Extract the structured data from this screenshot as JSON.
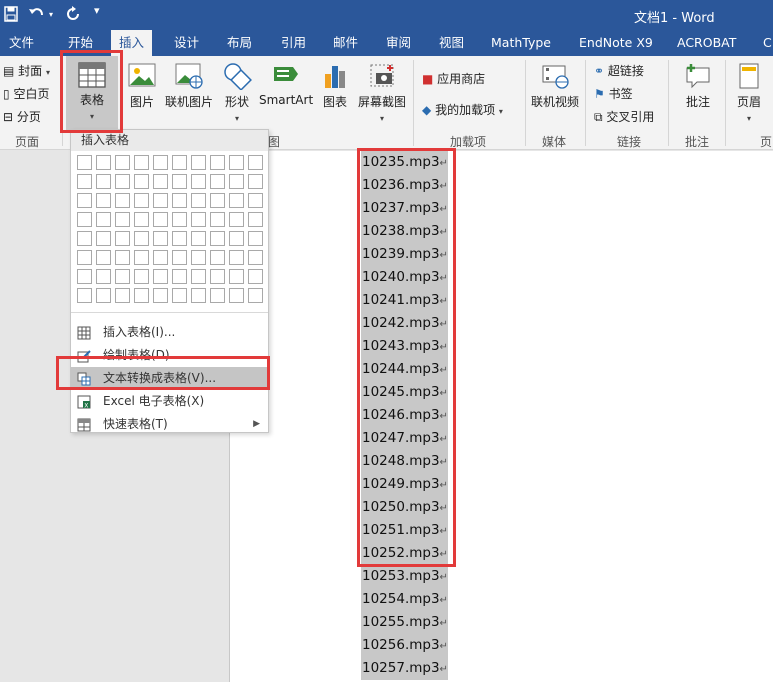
{
  "window": {
    "title": "文档1 - Word"
  },
  "tabs": [
    {
      "label": "文件"
    },
    {
      "label": "开始"
    },
    {
      "label": "插入"
    },
    {
      "label": "设计"
    },
    {
      "label": "布局"
    },
    {
      "label": "引用"
    },
    {
      "label": "邮件"
    },
    {
      "label": "审阅"
    },
    {
      "label": "视图"
    },
    {
      "label": "MathType"
    },
    {
      "label": "EndNote X9"
    },
    {
      "label": "ACROBAT"
    },
    {
      "label": "C"
    }
  ],
  "ribbon": {
    "pages": {
      "cover": "封面",
      "blank": "空白页",
      "break": "分页",
      "group": "页面"
    },
    "table": {
      "label": "表格"
    },
    "picture": "图片",
    "online_picture": "联机图片",
    "shapes": "形状",
    "smartart": "SmartArt",
    "chart": "图表",
    "screenshot": "屏幕截图",
    "illustrations_group_partial": "图",
    "store": "应用商店",
    "my_addins": "我的加载项",
    "addins_group": "加载项",
    "online_video": "联机视频",
    "media_group": "媒体",
    "hyperlink": "超链接",
    "bookmark": "书签",
    "cross_ref": "交叉引用",
    "links_group": "链接",
    "comment": "批注",
    "comments_group": "批注",
    "header": "页眉",
    "header_group_partial": "页"
  },
  "menu": {
    "header": "插入表格",
    "items": [
      {
        "label": "插入表格(I)..."
      },
      {
        "label": "绘制表格(D)"
      },
      {
        "label": "文本转换成表格(V)..."
      },
      {
        "label": "Excel 电子表格(X)"
      },
      {
        "label": "快速表格(T)"
      }
    ]
  },
  "document": {
    "lines": [
      "10235.mp3",
      "10236.mp3",
      "10237.mp3",
      "10238.mp3",
      "10239.mp3",
      "10240.mp3",
      "10241.mp3",
      "10242.mp3",
      "10243.mp3",
      "10244.mp3",
      "10245.mp3",
      "10246.mp3",
      "10247.mp3",
      "10248.mp3",
      "10249.mp3",
      "10250.mp3",
      "10251.mp3",
      "10252.mp3",
      "10253.mp3",
      "10254.mp3",
      "10255.mp3",
      "10256.mp3",
      "10257.mp3"
    ],
    "paragraph_mark": "↵"
  },
  "colors": {
    "title_bar": "#2b579a",
    "ribbon": "#f3f3f3",
    "annotation": "#e23a3a",
    "selection": "#c8c8c8"
  }
}
